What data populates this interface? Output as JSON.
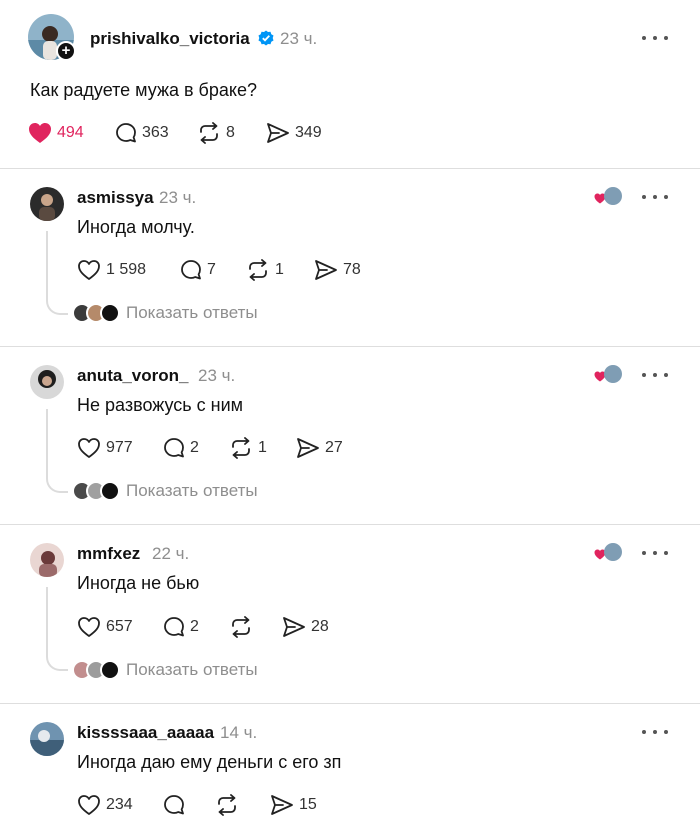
{
  "main_post": {
    "username": "prishivalko_victoria",
    "time": "23 ч.",
    "text": "Как радуете мужа в браке?",
    "likes": "494",
    "comments": "363",
    "reposts": "8",
    "shares": "349"
  },
  "replies_label": "Показать ответы",
  "colors": {
    "like_red": "#e0245e",
    "muted": "#8e8e8e",
    "divider": "#dedede"
  },
  "comments": [
    {
      "username": "asmissya",
      "time": "23 ч.",
      "text": "Иногда молчу.",
      "likes": "1 598",
      "comments": "7",
      "reposts": "1",
      "shares": "78"
    },
    {
      "username": "anuta_voron_",
      "time": "23 ч.",
      "text": "Не развожусь с ним",
      "likes": "977",
      "comments": "2",
      "reposts": "1",
      "shares": "27"
    },
    {
      "username": "mmfxez",
      "time": "22 ч.",
      "text": "Иногда не бью",
      "likes": "657",
      "comments": "2",
      "reposts": "",
      "shares": "28"
    },
    {
      "username": "kissssaaa_aaaaa",
      "time": "14 ч.",
      "text": "Иногда даю ему деньги с его зп",
      "likes": "234",
      "comments": "",
      "reposts": "",
      "shares": "15"
    }
  ]
}
